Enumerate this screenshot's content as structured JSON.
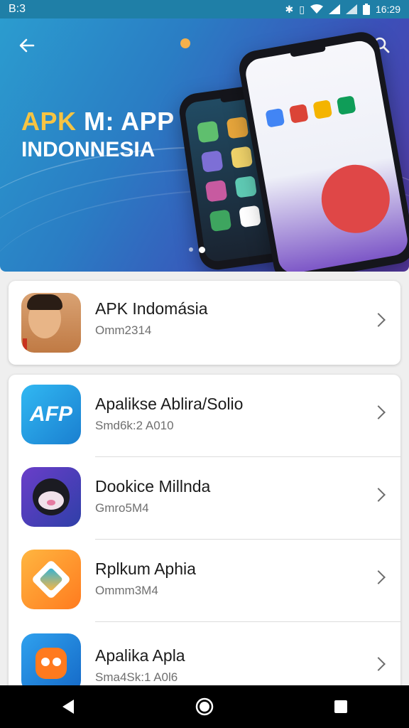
{
  "status_bar": {
    "time_left": "B:3",
    "time_right": "16:29",
    "icons": [
      "bluetooth-icon",
      "vibrate-icon",
      "wifi-icon",
      "signal-icon",
      "signal-icon",
      "battery-icon"
    ]
  },
  "hero": {
    "title_accent": "APK",
    "title_rest": " M: APP",
    "subtitle": "INDONNESIA",
    "page_count": 2,
    "active_page": 2
  },
  "featured": {
    "title": "APK Indomásia",
    "subtitle": "Omm2314"
  },
  "apps": [
    {
      "title": "Apalikse Ablira/Solio",
      "subtitle": "Smd6k:2 A010",
      "icon": "afp-app-icon",
      "icon_text": "AFP"
    },
    {
      "title": "Dookice Millnda",
      "subtitle": "Gmro5M4",
      "icon": "penguin-app-icon"
    },
    {
      "title": "Rplkum Aphia",
      "subtitle": "Ommm3M4",
      "icon": "diamond-app-icon"
    },
    {
      "title": "Apalika Apla",
      "subtitle": "Sma4Sk:1 A0l6",
      "icon": "owl-app-icon"
    }
  ],
  "colors": {
    "status_bar": "#1f7fa7",
    "hero_start": "#2b9ccf",
    "hero_end": "#5a3aa8",
    "accent_yellow": "#f6c443"
  }
}
